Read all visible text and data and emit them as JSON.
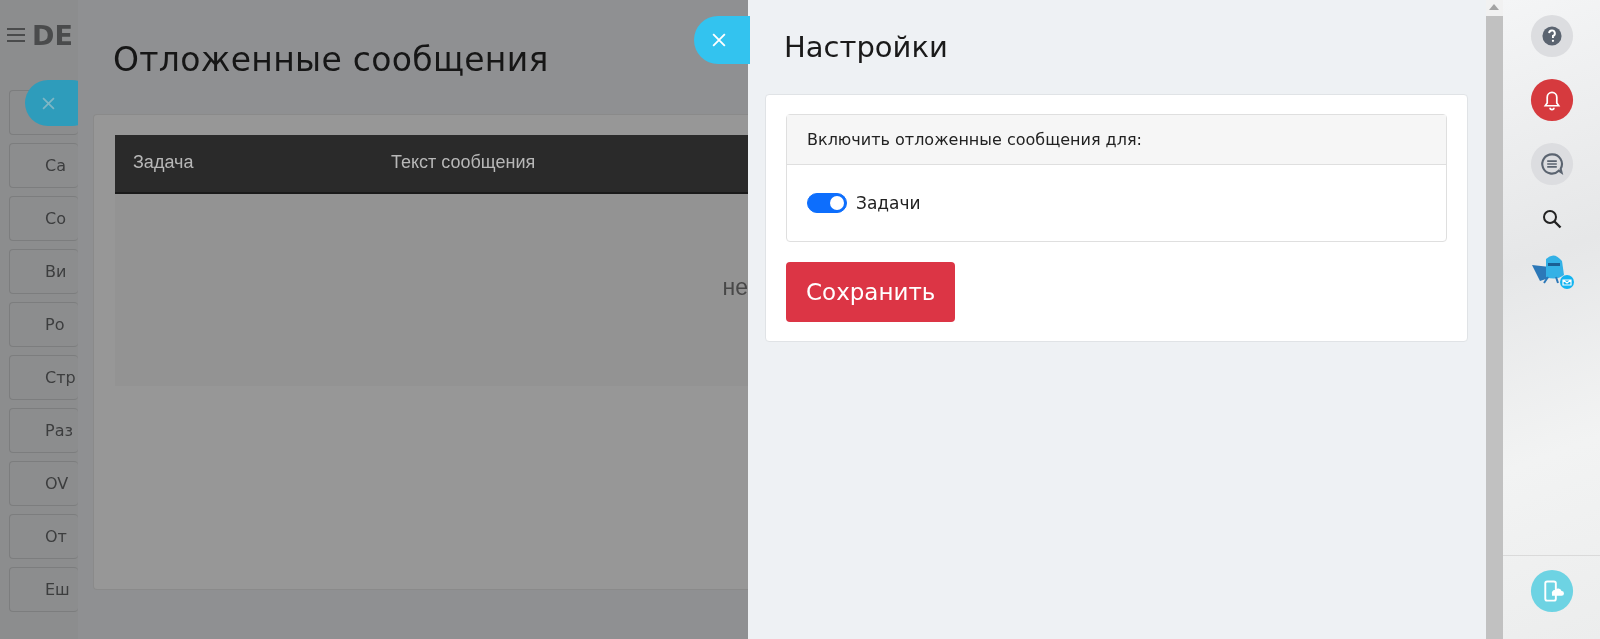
{
  "sidebar": {
    "title": "DE",
    "items": [
      "Са",
      "Со",
      "Ви",
      "Ро",
      "Стр",
      "Раз",
      "OV",
      "От",
      "Еш"
    ]
  },
  "messages_panel": {
    "title": "Отложенные сообщения",
    "columns": [
      "Задача",
      "Текст сообщения"
    ],
    "empty_text": "не"
  },
  "settings_panel": {
    "title": "Настройки",
    "section_title": "Включить отложенные сообщения для:",
    "toggles": [
      {
        "label": "Задачи",
        "on": true
      }
    ],
    "save_button": "Сохранить"
  }
}
